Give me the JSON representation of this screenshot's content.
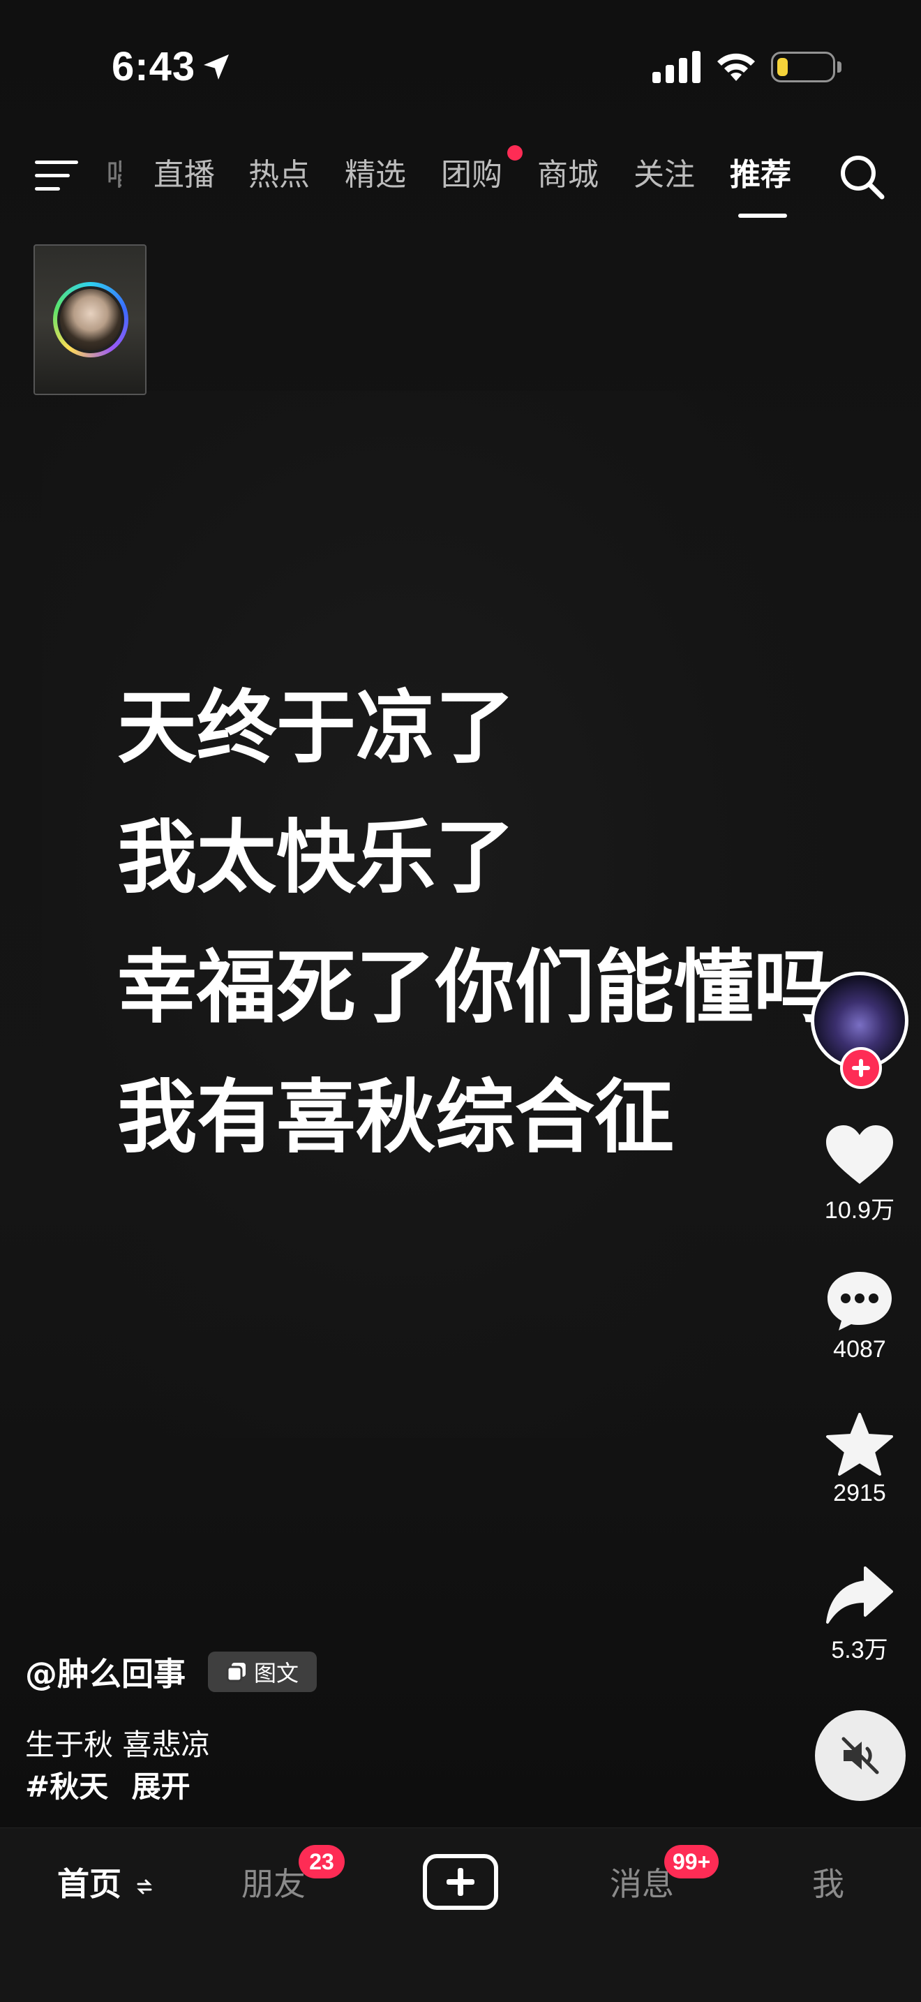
{
  "status_bar": {
    "time": "6:43",
    "battery_level": 0.2,
    "icons": [
      "location-arrow-icon",
      "cellular-signal-icon",
      "wifi-icon",
      "battery-icon"
    ]
  },
  "top_nav": {
    "partial_tab": "唱",
    "tabs": [
      {
        "label": "直播",
        "active": false
      },
      {
        "label": "热点",
        "active": false
      },
      {
        "label": "精选",
        "active": false
      },
      {
        "label": "团购",
        "active": false,
        "dot": true
      },
      {
        "label": "商城",
        "active": false
      },
      {
        "label": "关注",
        "active": false
      },
      {
        "label": "推荐",
        "active": true
      }
    ],
    "menu_icon": "hamburger-menu-icon",
    "search_icon": "search-icon"
  },
  "post": {
    "lines": [
      "天终于凉了",
      "我太快乐了",
      "幸福死了你们能懂吗",
      "我有喜秋综合征"
    ]
  },
  "rail": {
    "likes": "10.9万",
    "comments": "4087",
    "favorites": "2915",
    "shares": "5.3万"
  },
  "caption": {
    "author": "@肿么回事",
    "badge": "图文",
    "description": "生于秋 喜悲凉",
    "hashtag": "#秋天",
    "expand": "展开"
  },
  "bottom_nav": {
    "home": "首页",
    "friends": "朋友",
    "friends_badge": "23",
    "messages": "消息",
    "messages_badge": "99+",
    "me": "我"
  },
  "colors": {
    "accent": "#fe2c55",
    "background": "#111111",
    "battery": "#f5d33a"
  }
}
